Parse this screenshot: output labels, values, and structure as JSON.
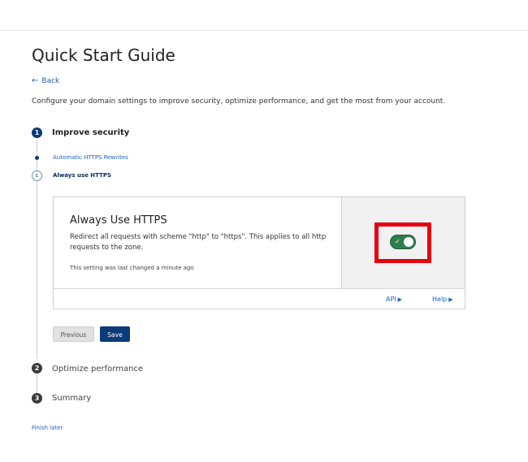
{
  "header": {
    "title": "Quick Start Guide",
    "back_label": "Back",
    "description": "Configure your domain settings to improve security, optimize performance, and get the most from your account."
  },
  "steps": [
    {
      "number": "1",
      "label": "Improve security"
    },
    {
      "number": "2",
      "label": "Optimize performance"
    },
    {
      "number": "3",
      "label": "Summary"
    }
  ],
  "substeps": [
    {
      "label": "Automatic HTTPS Rewrites"
    },
    {
      "marker": "c",
      "label": "Always use HTTPS"
    }
  ],
  "card": {
    "title": "Always Use HTTPS",
    "description": "Redirect all requests with scheme \"http\" to \"https\". This applies to all http requests to the zone.",
    "last_changed": "This setting was last changed a minute ago",
    "toggle_check": "✓",
    "api_label": "API",
    "help_label": "Help"
  },
  "buttons": {
    "previous": "Previous",
    "save": "Save"
  },
  "footer": {
    "finish_later": "Finish later"
  },
  "colors": {
    "accent": "#0a3a78",
    "link": "#1f5fb8",
    "toggle_on": "#2e7d4f",
    "highlight": "#e8000f"
  }
}
